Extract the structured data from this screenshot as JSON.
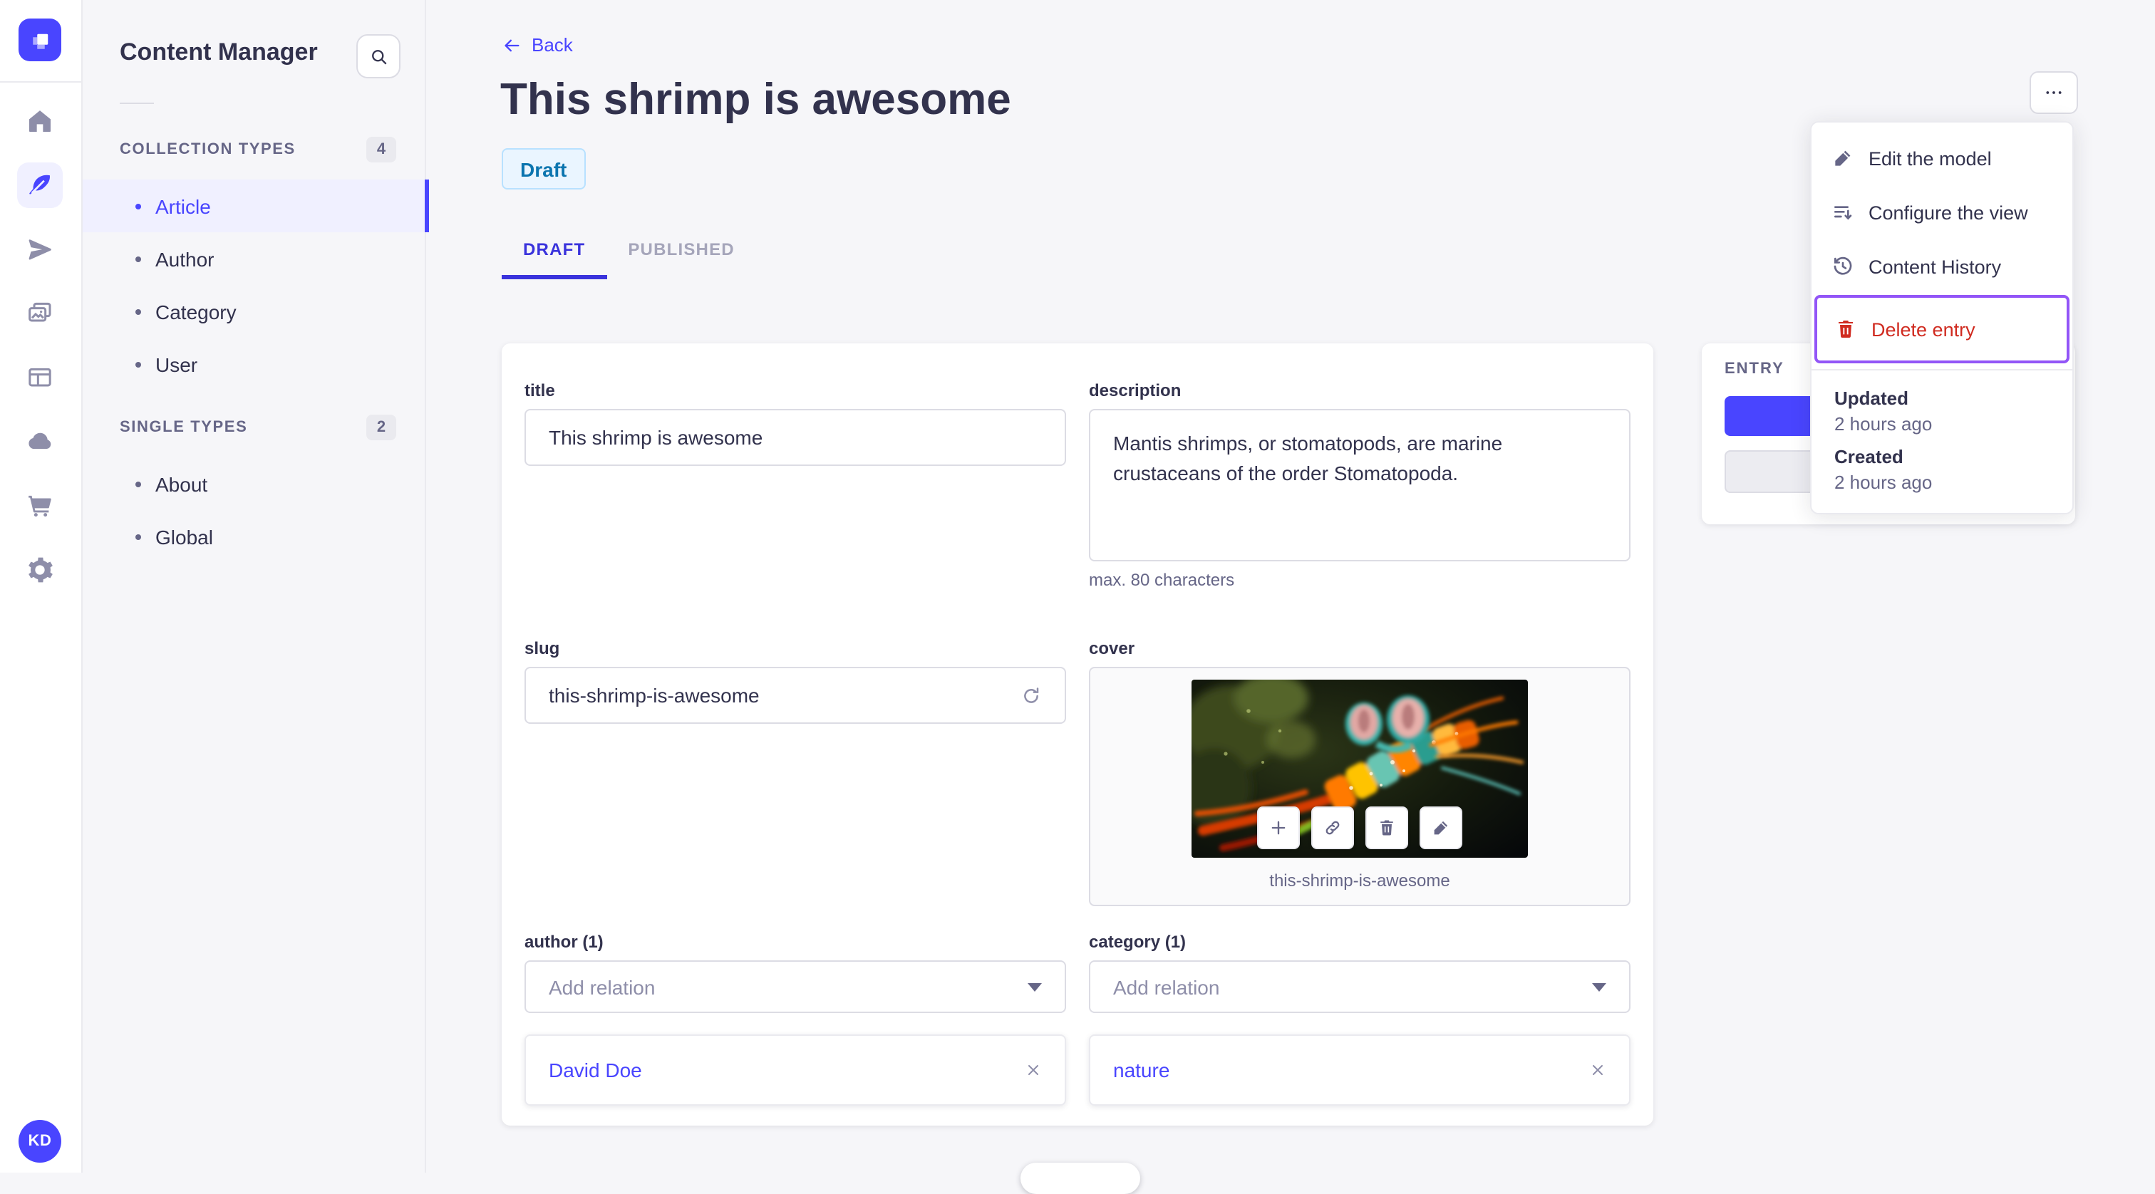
{
  "nav": {
    "icons": [
      "home",
      "content-manager",
      "releases",
      "media-library",
      "content-type-builder",
      "deploy",
      "marketplace",
      "settings"
    ],
    "active_icon": "content-manager",
    "avatar_initials": "KD"
  },
  "subnav": {
    "title": "Content Manager",
    "sections": [
      {
        "label": "COLLECTION TYPES",
        "count": "4",
        "items": [
          "Article",
          "Author",
          "Category",
          "User"
        ],
        "active_item": "Article"
      },
      {
        "label": "SINGLE TYPES",
        "count": "2",
        "items": [
          "About",
          "Global"
        ]
      }
    ]
  },
  "header": {
    "back_label": "Back",
    "title": "This shrimp is awesome",
    "status": "Draft"
  },
  "tabs": {
    "draft": "DRAFT",
    "published": "PUBLISHED"
  },
  "form": {
    "title": {
      "label": "title",
      "value": "This shrimp is awesome"
    },
    "description": {
      "label": "description",
      "value": "Mantis shrimps, or stomatopods, are marine crustaceans of the order Stomatopoda.",
      "helper": "max. 80 characters"
    },
    "slug": {
      "label": "slug",
      "value": "this-shrimp-is-awesome"
    },
    "cover": {
      "label": "cover",
      "caption": "this-shrimp-is-awesome"
    },
    "author": {
      "label": "author (1)",
      "placeholder": "Add relation",
      "relation": "David Doe"
    },
    "category": {
      "label": "category (1)",
      "placeholder": "Add relation",
      "relation": "nature"
    }
  },
  "entry_panel": {
    "label": "ENTRY"
  },
  "menu": {
    "items": [
      {
        "label": "Edit the model"
      },
      {
        "label": "Configure the view"
      },
      {
        "label": "Content History"
      },
      {
        "label": "Delete entry"
      }
    ],
    "meta": [
      {
        "label": "Updated",
        "value": "2 hours ago"
      },
      {
        "label": "Created",
        "value": "2 hours ago"
      }
    ]
  },
  "colors": {
    "primary": "#4945ff",
    "primary_light": "#f0f0ff",
    "danger": "#d02b20",
    "focus_ring": "#9255f7",
    "draft_bg": "#eaf5ff",
    "draft_text": "#0c75af"
  }
}
